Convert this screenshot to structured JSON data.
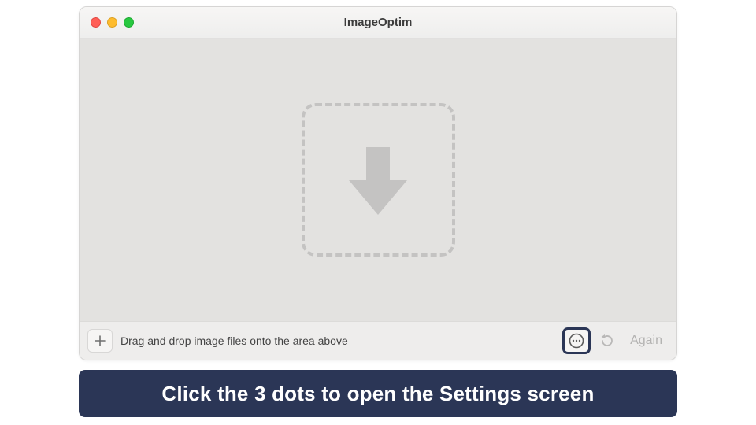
{
  "window": {
    "title": "ImageOptim"
  },
  "dropzone": {
    "icon": "arrow-down"
  },
  "bottombar": {
    "add_icon": "plus",
    "hint": "Drag and drop image files onto the area above",
    "more_icon": "ellipsis",
    "refresh_icon": "refresh",
    "again_label": "Again"
  },
  "callout": {
    "text": "Click the 3 dots to open the Settings screen"
  },
  "colors": {
    "accent": "#2b3656"
  }
}
